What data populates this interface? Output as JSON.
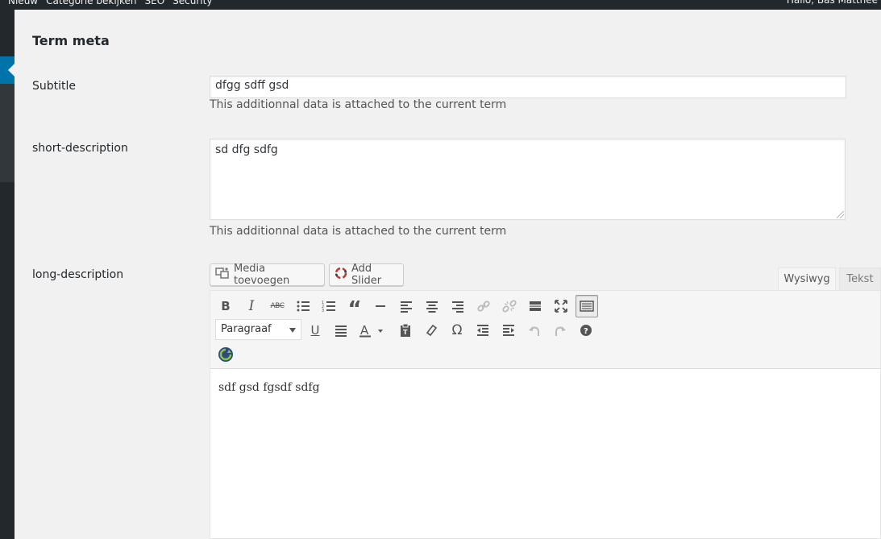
{
  "adminbar": {
    "left_items": [
      "Nieuw",
      "Categorie bekijken",
      "SEO",
      "Security"
    ],
    "right_text": "Hallo, Bas Matthee"
  },
  "section": {
    "title": "Term meta"
  },
  "fields": {
    "subtitle": {
      "label": "Subtitle",
      "value": "dfgg sdff gsd",
      "description": "This additionnal data is attached to the current term"
    },
    "short_description": {
      "label": "short-description",
      "value": "sd dfg sdfg",
      "description": "This additionnal data is attached to the current term"
    },
    "long_description": {
      "label": "long-description",
      "content": "sdf gsd fgsdf sdfg"
    }
  },
  "media_buttons": {
    "media_label": "Media toevoegen",
    "slider_label": "Add Slider"
  },
  "editor_tabs": {
    "visual": "Wysiwyg",
    "text": "Tekst"
  },
  "toolbar": {
    "format_select": "Paragraaf"
  }
}
